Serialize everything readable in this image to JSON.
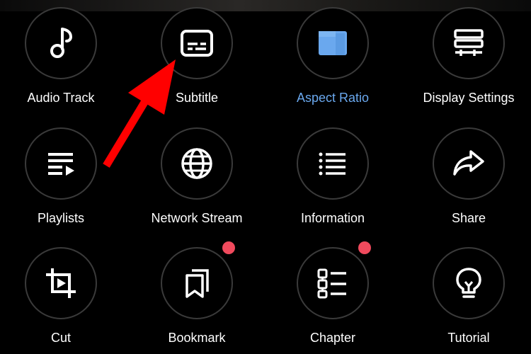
{
  "menu": {
    "items": [
      {
        "label": "Audio Track",
        "icon": "music-note-icon",
        "active": false
      },
      {
        "label": "Subtitle",
        "icon": "subtitle-icon",
        "active": false
      },
      {
        "label": "Aspect Ratio",
        "icon": "aspect-ratio-icon",
        "active": true
      },
      {
        "label": "Display Settings",
        "icon": "display-settings-icon",
        "active": false
      },
      {
        "label": "Playlists",
        "icon": "playlist-icon",
        "active": false
      },
      {
        "label": "Network Stream",
        "icon": "globe-icon",
        "active": false
      },
      {
        "label": "Information",
        "icon": "info-list-icon",
        "active": false
      },
      {
        "label": "Share",
        "icon": "share-icon",
        "active": false
      },
      {
        "label": "Cut",
        "icon": "cut-crop-icon",
        "active": false
      },
      {
        "label": "Bookmark",
        "icon": "bookmark-icon",
        "active": false,
        "badge": true
      },
      {
        "label": "Chapter",
        "icon": "chapter-icon",
        "active": false,
        "badge": true
      },
      {
        "label": "Tutorial",
        "icon": "lightbulb-icon",
        "active": false
      }
    ]
  },
  "colors": {
    "background": "#000000",
    "text": "#ffffff",
    "accent": "#6aa8ee",
    "badge": "#f04a5d",
    "annotation_arrow": "#ff0000"
  }
}
